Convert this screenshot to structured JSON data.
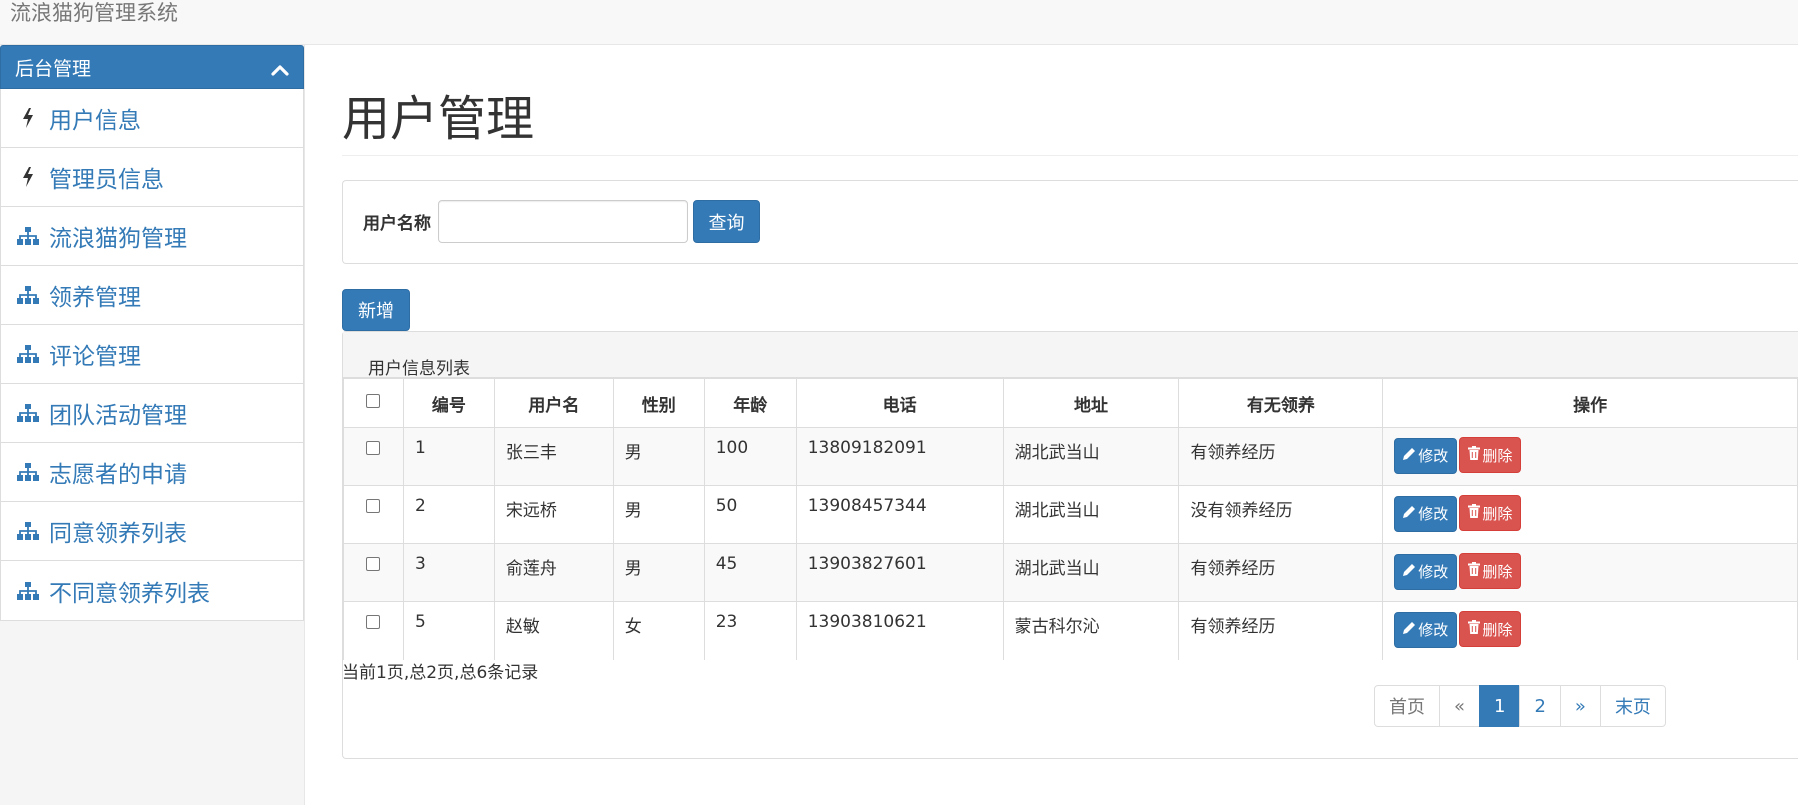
{
  "header": {
    "brand": "流浪猫狗管理系统"
  },
  "sidebar": {
    "panel_title": "后台管理",
    "items": [
      {
        "label": "用户信息",
        "icon": "bolt-icon"
      },
      {
        "label": "管理员信息",
        "icon": "bolt-icon"
      },
      {
        "label": "流浪猫狗管理",
        "icon": "sitemap-icon"
      },
      {
        "label": "领养管理",
        "icon": "sitemap-icon"
      },
      {
        "label": "评论管理",
        "icon": "sitemap-icon"
      },
      {
        "label": "团队活动管理",
        "icon": "sitemap-icon"
      },
      {
        "label": "志愿者的申请",
        "icon": "sitemap-icon"
      },
      {
        "label": "同意领养列表",
        "icon": "sitemap-icon"
      },
      {
        "label": "不同意领养列表",
        "icon": "sitemap-icon"
      }
    ]
  },
  "main": {
    "title": "用户管理",
    "search": {
      "label": "用户名称",
      "value": "",
      "placeholder": "",
      "button": "查询"
    },
    "add_button": "新增",
    "list_title": "用户信息列表",
    "columns": [
      "编号",
      "用户名",
      "性别",
      "年龄",
      "电话",
      "地址",
      "有无领养",
      "操作"
    ],
    "rows": [
      {
        "id": "1",
        "name": "张三丰",
        "gender": "男",
        "age": "100",
        "phone": "13809182091",
        "address": "湖北武当山",
        "adopted": "有领养经历"
      },
      {
        "id": "2",
        "name": "宋远桥",
        "gender": "男",
        "age": "50",
        "phone": "13908457344",
        "address": "湖北武当山",
        "adopted": "没有领养经历"
      },
      {
        "id": "3",
        "name": "俞莲舟",
        "gender": "男",
        "age": "45",
        "phone": "13903827601",
        "address": "湖北武当山",
        "adopted": "有领养经历"
      },
      {
        "id": "5",
        "name": "赵敏",
        "gender": "女",
        "age": "23",
        "phone": "13903810621",
        "address": "蒙古科尔沁",
        "adopted": "有领养经历"
      }
    ],
    "edit_label": "修改",
    "delete_label": "删除",
    "page_info": "当前1页,总2页,总6条记录",
    "pagination": [
      "首页",
      "«",
      "1",
      "2",
      "»",
      "末页"
    ],
    "current_page": "1"
  },
  "colors": {
    "primary": "#337ab7",
    "danger": "#d9534f",
    "border": "#dddddd"
  }
}
